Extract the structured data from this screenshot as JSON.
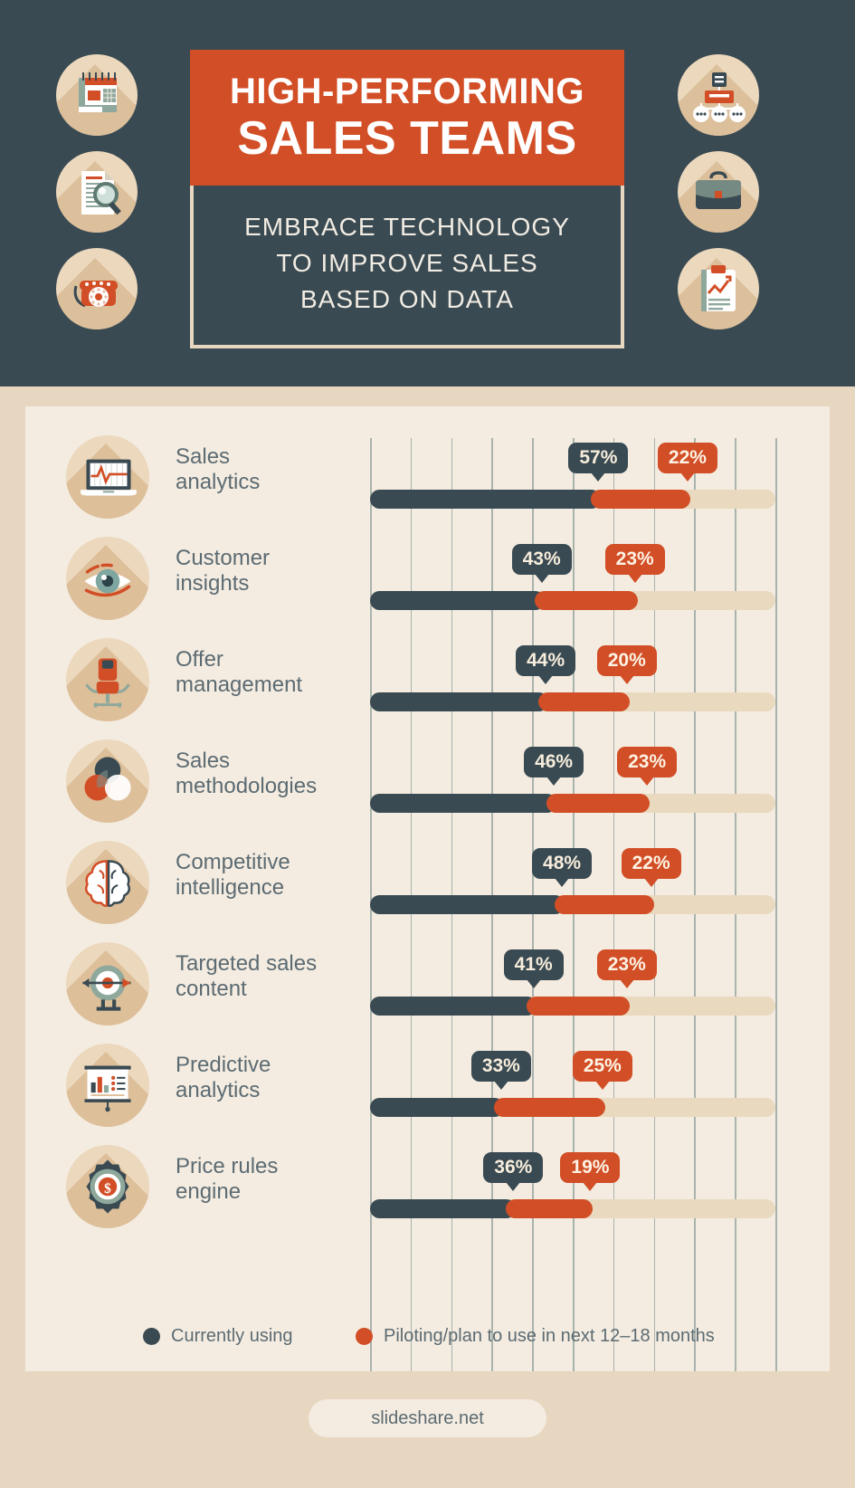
{
  "header": {
    "title_line1": "HIGH-PERFORMING",
    "title_line2": "SALES TEAMS",
    "subtitle_line1": "EMBRACE TECHNOLOGY",
    "subtitle_line2": "TO IMPROVE SALES",
    "subtitle_line3": "BASED ON DATA",
    "title_bg": "#d24e26",
    "panel_bg": "#3a4a52",
    "left_icons": [
      {
        "name": "calendar-notepad-icon"
      },
      {
        "name": "document-magnifier-icon"
      },
      {
        "name": "telephone-icon"
      }
    ],
    "right_icons": [
      {
        "name": "org-chart-icon"
      },
      {
        "name": "briefcase-icon"
      },
      {
        "name": "clipboard-chart-icon"
      }
    ]
  },
  "chart_data": {
    "type": "bar",
    "title": "",
    "xlabel": "",
    "ylabel": "",
    "xlim": [
      0,
      100
    ],
    "grid": true,
    "grid_step": 10,
    "legend_position": "bottom",
    "categories": [
      "Sales analytics",
      "Customer insights",
      "Offer management",
      "Sales methodologies",
      "Competitive intelligence",
      "Targeted sales content",
      "Predictive analytics",
      "Price rules engine"
    ],
    "series": [
      {
        "name": "Currently using",
        "color": "#3a4a52",
        "values": [
          57,
          43,
          44,
          46,
          48,
          41,
          33,
          36
        ]
      },
      {
        "name": "Piloting/plan to use in next 12–18 months",
        "color": "#d24e26",
        "values": [
          22,
          23,
          20,
          23,
          22,
          23,
          25,
          19
        ]
      }
    ]
  },
  "rows": [
    {
      "label_l1": "Sales",
      "label_l2": "analytics",
      "icon": "laptop-chart-icon",
      "used": 57,
      "used_text": "57%",
      "pilot": 22,
      "pilot_text": "22%"
    },
    {
      "label_l1": "Customer",
      "label_l2": "insights",
      "icon": "eye-icon",
      "used": 43,
      "used_text": "43%",
      "pilot": 23,
      "pilot_text": "23%"
    },
    {
      "label_l1": "Offer",
      "label_l2": "management",
      "icon": "office-chair-icon",
      "used": 44,
      "used_text": "44%",
      "pilot": 20,
      "pilot_text": "20%"
    },
    {
      "label_l1": "Sales",
      "label_l2": "methodologies",
      "icon": "venn-diagram-icon",
      "used": 46,
      "used_text": "46%",
      "pilot": 23,
      "pilot_text": "23%"
    },
    {
      "label_l1": "Competitive",
      "label_l2": "intelligence",
      "icon": "brain-icon",
      "used": 48,
      "used_text": "48%",
      "pilot": 22,
      "pilot_text": "22%"
    },
    {
      "label_l1": "Targeted sales",
      "label_l2": "content",
      "icon": "target-arrow-icon",
      "used": 41,
      "used_text": "41%",
      "pilot": 23,
      "pilot_text": "23%"
    },
    {
      "label_l1": "Predictive",
      "label_l2": "analytics",
      "icon": "presentation-board-icon",
      "used": 33,
      "used_text": "33%",
      "pilot": 25,
      "pilot_text": "25%"
    },
    {
      "label_l1": "Price rules",
      "label_l2": "engine",
      "icon": "gear-dollar-icon",
      "used": 36,
      "used_text": "36%",
      "pilot": 19,
      "pilot_text": "19%"
    }
  ],
  "legend": {
    "items": [
      {
        "label": "Currently using",
        "color": "#3a4a52"
      },
      {
        "label": "Piloting/plan to use in next 12–18 months",
        "color": "#d24e26"
      }
    ]
  },
  "footer": {
    "source": "slideshare.net"
  },
  "colors": {
    "dark": "#3a4a52",
    "orange": "#d24e26",
    "cream": "#f4ece1",
    "sand": "#e7d7c1",
    "track": "#e9d9bf",
    "icon_circle": "#ecd8bd"
  }
}
